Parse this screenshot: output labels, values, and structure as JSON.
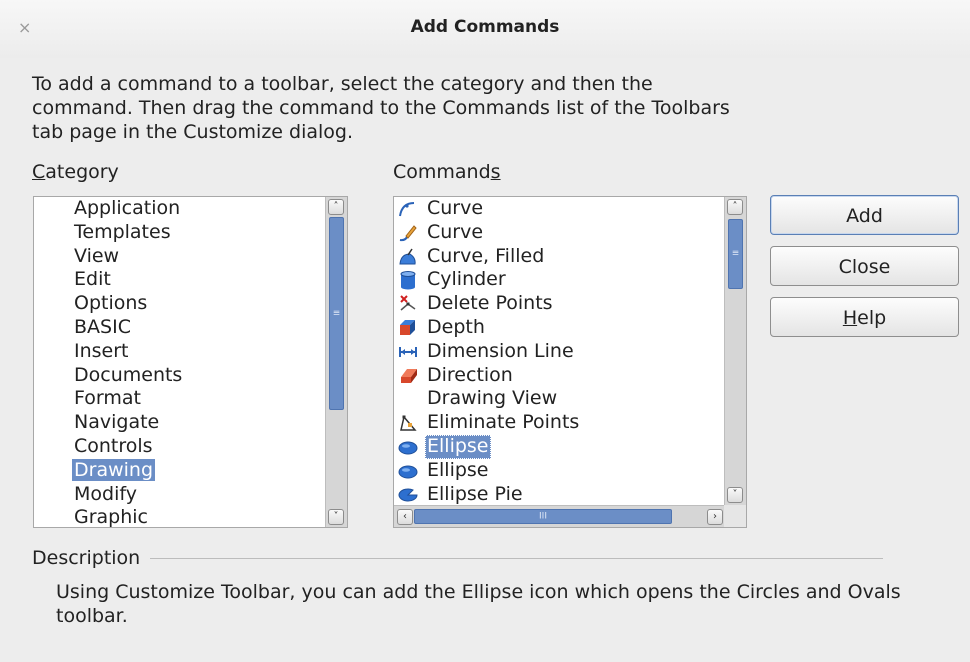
{
  "window": {
    "title": "Add Commands",
    "close_glyph": "×"
  },
  "intro": "To add a command to a toolbar, select the category and then the command. Then drag the command to the Commands list of the Toolbars tab page in the Customize dialog.",
  "category": {
    "label_first": "C",
    "label_rest": "ategory",
    "items": [
      "Application",
      "Templates",
      "View",
      "Edit",
      "Options",
      "BASIC",
      "Insert",
      "Documents",
      "Format",
      "Navigate",
      "Controls",
      "Drawing",
      "Modify",
      "Graphic"
    ],
    "selected": "Drawing"
  },
  "commands": {
    "label_start": "Command",
    "label_underlined": "s",
    "items": [
      {
        "label": "Curve",
        "icon": "curve-icon"
      },
      {
        "label": "Curve",
        "icon": "freeform-curve-icon"
      },
      {
        "label": "Curve, Filled",
        "icon": "curve-filled-icon"
      },
      {
        "label": "Cylinder",
        "icon": "cylinder-icon"
      },
      {
        "label": "Delete Points",
        "icon": "delete-points-icon"
      },
      {
        "label": "Depth",
        "icon": "depth-icon"
      },
      {
        "label": "Dimension Line",
        "icon": "dimension-line-icon"
      },
      {
        "label": "Direction",
        "icon": "direction-icon"
      },
      {
        "label": "Drawing View",
        "icon": ""
      },
      {
        "label": "Eliminate Points",
        "icon": "eliminate-points-icon"
      },
      {
        "label": "Ellipse",
        "icon": "ellipse-icon"
      },
      {
        "label": "Ellipse",
        "icon": "ellipse-icon"
      },
      {
        "label": "Ellipse Pie",
        "icon": "ellipse-pie-icon"
      }
    ],
    "selected_index": 10
  },
  "buttons": {
    "add": "Add",
    "close": "Close",
    "help_first": "H",
    "help_rest": "elp"
  },
  "description": {
    "label": "Description",
    "text": "Using Customize Toolbar, you can add the Ellipse icon which opens the Circles and Ovals toolbar."
  },
  "colors": {
    "selection": "#6b8ec6",
    "background": "#ededed"
  }
}
